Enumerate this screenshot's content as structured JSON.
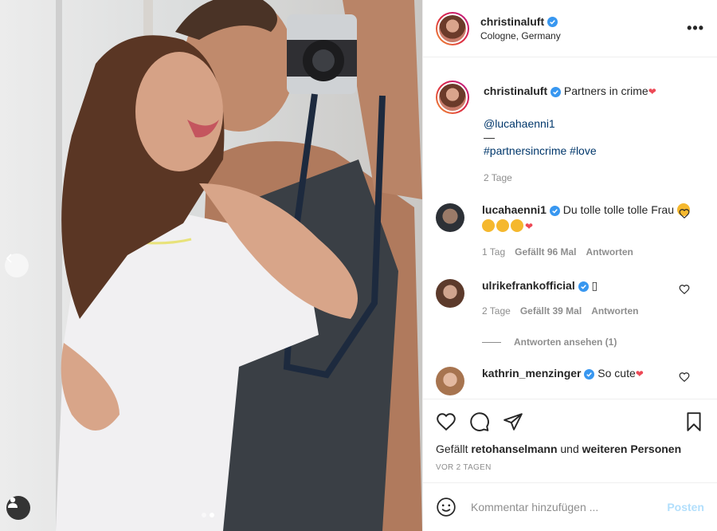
{
  "post": {
    "username": "christinaluft",
    "location": "Cologne, Germany",
    "more_label": "•••"
  },
  "caption": {
    "username": "christinaluft",
    "text": "Partners in crime",
    "mention": "@lucahaenni1",
    "separator": "—",
    "hashtags": "#partnersincrime #love",
    "time": "2 Tage"
  },
  "comments": [
    {
      "username": "lucahaenni1",
      "text": "Du tolle tolle tolle Frau",
      "time": "1 Tag",
      "likes": "Gefällt 96 Mal",
      "reply": "Antworten"
    },
    {
      "username": "ulrikefrankofficial",
      "text": "▯",
      "time": "2 Tage",
      "likes": "Gefällt 39 Mal",
      "reply": "Antworten",
      "view_replies": "Antworten ansehen (1)"
    },
    {
      "username": "kathrin_menzinger",
      "text": "So cute"
    }
  ],
  "likes": {
    "prefix": "Gefällt",
    "user": "retohanselmann",
    "middle": "und",
    "suffix": "weiteren Personen"
  },
  "timestamp": "VOR 2 TAGEN",
  "add_comment": {
    "placeholder": "Kommentar hinzufügen ...",
    "post_label": "Posten"
  },
  "colors": {
    "link": "#00376b",
    "verified": "#3897f0",
    "muted": "#8e8e8e",
    "post_disabled": "#b2dffc"
  },
  "carousel": {
    "slide_count": 2,
    "active_slide": 2
  }
}
